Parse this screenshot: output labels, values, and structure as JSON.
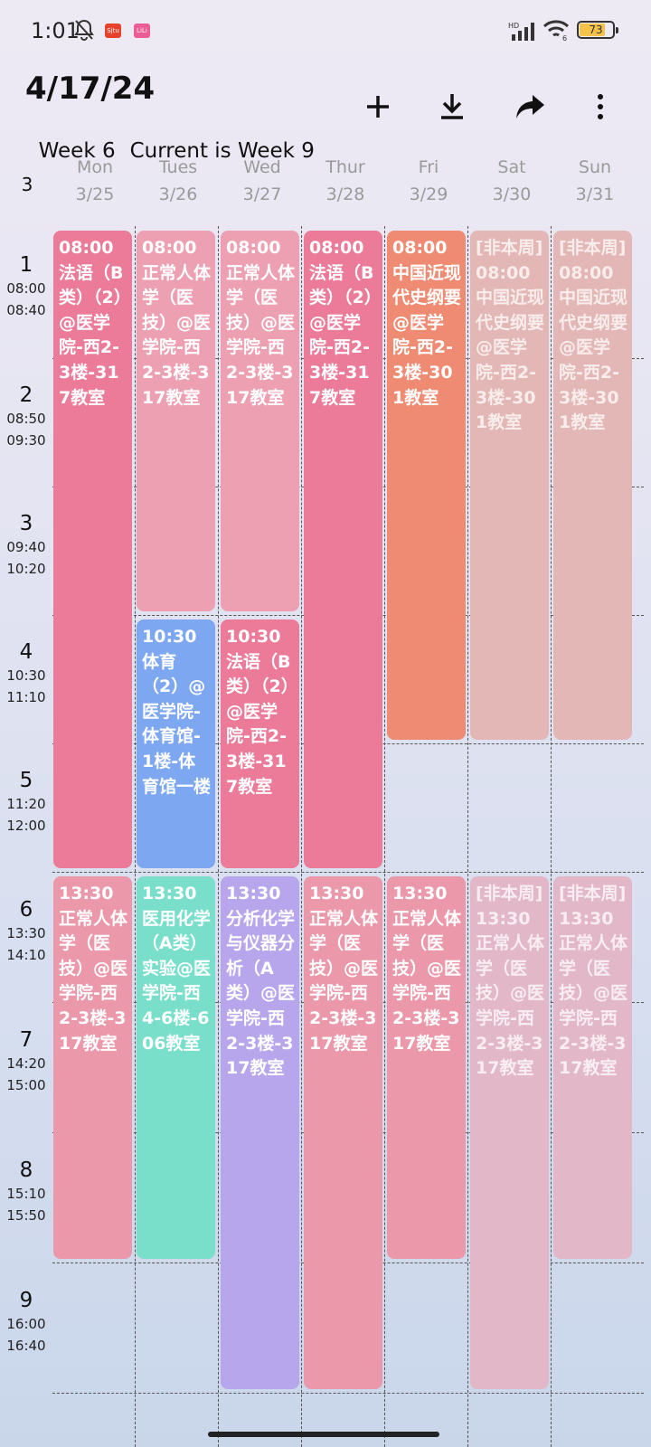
{
  "status_bar": {
    "time": "1:01",
    "battery": "73",
    "app_badge_1": "Sjtu",
    "app_badge_2": "LiLi",
    "icons": [
      "mute-bell-icon",
      "app-badge-icon",
      "app-badge-icon",
      "signal-icon",
      "wifi-icon",
      "battery-icon"
    ]
  },
  "header": {
    "date": "4/17/24",
    "week": "Week 6",
    "current_week": "Current is Week 9",
    "actions": [
      "plus-icon",
      "download-icon",
      "share-icon",
      "more-vert-icon"
    ]
  },
  "grid": {
    "week_number": "3",
    "days": [
      {
        "name": "Mon",
        "date": "3/25"
      },
      {
        "name": "Tues",
        "date": "3/26"
      },
      {
        "name": "Wed",
        "date": "3/27"
      },
      {
        "name": "Thur",
        "date": "3/28"
      },
      {
        "name": "Fri",
        "date": "3/29"
      },
      {
        "name": "Sat",
        "date": "3/30"
      },
      {
        "name": "Sun",
        "date": "3/31"
      }
    ],
    "periods": [
      {
        "num": "1",
        "start": "08:00",
        "end": "08:40"
      },
      {
        "num": "2",
        "start": "08:50",
        "end": "09:30"
      },
      {
        "num": "3",
        "start": "09:40",
        "end": "10:20"
      },
      {
        "num": "4",
        "start": "10:30",
        "end": "11:10"
      },
      {
        "num": "5",
        "start": "11:20",
        "end": "12:00"
      },
      {
        "num": "6",
        "start": "13:30",
        "end": "14:10"
      },
      {
        "num": "7",
        "start": "14:20",
        "end": "15:00"
      },
      {
        "num": "8",
        "start": "15:10",
        "end": "15:50"
      },
      {
        "num": "9",
        "start": "16:00",
        "end": "16:40"
      }
    ]
  },
  "courses": [
    {
      "day": 0,
      "start": 1,
      "end": 5,
      "color": "#ec7b99",
      "faded": false,
      "text": "08:00\n法语（B类）（2）@医学院-西2-3楼-317教室"
    },
    {
      "day": 1,
      "start": 1,
      "end": 3,
      "color": "#eea0b3",
      "faded": false,
      "text": "08:00\n正常人体学（医技）@医学院-西2-3楼-317教室"
    },
    {
      "day": 2,
      "start": 1,
      "end": 3,
      "color": "#eea0b3",
      "faded": false,
      "text": "08:00\n正常人体学（医技）@医学院-西2-3楼-317教室"
    },
    {
      "day": 3,
      "start": 1,
      "end": 5,
      "color": "#ec7b99",
      "faded": false,
      "text": "08:00\n法语（B类）（2）@医学院-西2-3楼-317教室"
    },
    {
      "day": 4,
      "start": 1,
      "end": 4,
      "color": "#ee8b72",
      "faded": false,
      "text": "08:00\n中国近现代史纲要@医学院-西2-3楼-301教室"
    },
    {
      "day": 5,
      "start": 1,
      "end": 4,
      "color": "#e2b7b5",
      "faded": true,
      "text": "[非本周]\n08:00\n中国近现代史纲要@医学院-西2-3楼-301教室"
    },
    {
      "day": 6,
      "start": 1,
      "end": 4,
      "color": "#e2b7b5",
      "faded": true,
      "text": "[非本周]\n08:00\n中国近现代史纲要@医学院-西2-3楼-301教室"
    },
    {
      "day": 1,
      "start": 4,
      "end": 5,
      "color": "#7ea7f2",
      "faded": false,
      "text": "10:30\n体育（2）@医学院-体育馆-1楼-体育馆一楼"
    },
    {
      "day": 2,
      "start": 4,
      "end": 5,
      "color": "#ec7b99",
      "faded": false,
      "text": "10:30\n法语（B类）（2）@医学院-西2-3楼-317教室"
    },
    {
      "day": 0,
      "start": 6,
      "end": 8,
      "color": "#eb98aa",
      "faded": false,
      "text": "13:30\n正常人体学（医技）@医学院-西2-3楼-317教室"
    },
    {
      "day": 1,
      "start": 6,
      "end": 8,
      "color": "#79dfcb",
      "faded": false,
      "text": "13:30\n医用化学（A类）实验@医学院-西4-6楼-606教室"
    },
    {
      "day": 2,
      "start": 6,
      "end": 9,
      "color": "#b7a6ec",
      "faded": false,
      "text": "13:30\n分析化学与仪器分析（A类）@医学院-西2-3楼-317教室"
    },
    {
      "day": 3,
      "start": 6,
      "end": 9,
      "color": "#eb98aa",
      "faded": false,
      "text": "13:30\n正常人体学（医技）@医学院-西2-3楼-317教室"
    },
    {
      "day": 4,
      "start": 6,
      "end": 8,
      "color": "#eb98aa",
      "faded": false,
      "text": "13:30\n正常人体学（医技）@医学院-西2-3楼-317教室"
    },
    {
      "day": 5,
      "start": 6,
      "end": 9,
      "color": "#e2b8c8",
      "faded": true,
      "text": "[非本周]\n13:30\n正常人体学（医技）@医学院-西2-3楼-317教室"
    },
    {
      "day": 6,
      "start": 6,
      "end": 8,
      "color": "#e2b8c8",
      "faded": true,
      "text": "[非本周]\n13:30\n正常人体学（医技）@医学院-西2-3楼-317教室"
    }
  ]
}
